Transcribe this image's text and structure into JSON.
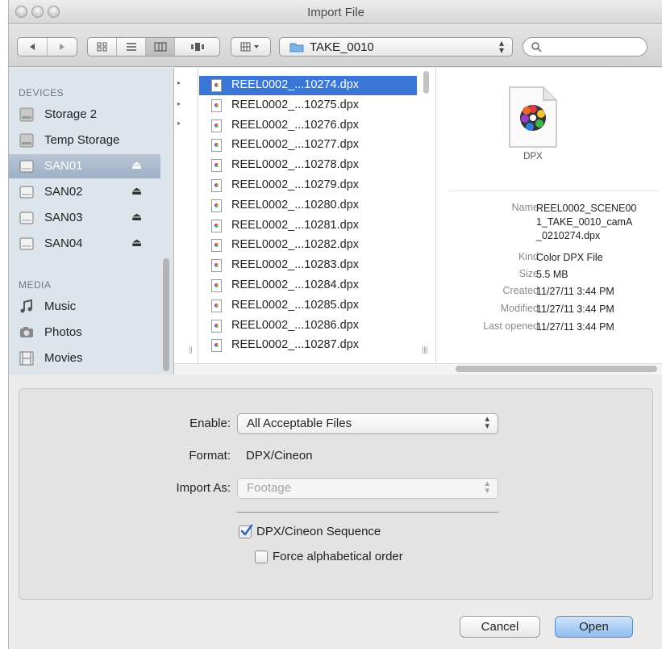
{
  "window": {
    "title": "Import File"
  },
  "toolbar": {
    "nav_back_icon": "back-arrow-icon",
    "nav_forward_icon": "forward-arrow-icon",
    "view_modes": [
      "icon-view",
      "list-view",
      "column-view",
      "coverflow-view"
    ],
    "active_view": "column-view",
    "arrange_icon": "arrange-grid-icon",
    "path": "TAKE_0010",
    "search_placeholder": ""
  },
  "sidebar": {
    "devices_header": "DEVICES",
    "devices": [
      {
        "label": "Storage 2",
        "icon": "internal-disk-icon",
        "eject": false,
        "selected": false
      },
      {
        "label": "Temp Storage",
        "icon": "internal-disk-icon",
        "eject": false,
        "selected": false
      },
      {
        "label": "SAN01",
        "icon": "external-disk-icon",
        "eject": true,
        "selected": true
      },
      {
        "label": "SAN02",
        "icon": "external-disk-icon",
        "eject": true,
        "selected": false
      },
      {
        "label": "SAN03",
        "icon": "external-disk-icon",
        "eject": true,
        "selected": false
      },
      {
        "label": "SAN04",
        "icon": "external-disk-icon",
        "eject": true,
        "selected": false
      }
    ],
    "media_header": "MEDIA",
    "media": [
      {
        "label": "Music",
        "icon": "music-note-icon"
      },
      {
        "label": "Photos",
        "icon": "camera-icon"
      },
      {
        "label": "Movies",
        "icon": "film-icon"
      }
    ],
    "eject_symbol": "⏏"
  },
  "files": [
    "REEL0002_...10274.dpx",
    "REEL0002_...10275.dpx",
    "REEL0002_...10276.dpx",
    "REEL0002_...10277.dpx",
    "REEL0002_...10278.dpx",
    "REEL0002_...10279.dpx",
    "REEL0002_...10280.dpx",
    "REEL0002_...10281.dpx",
    "REEL0002_...10282.dpx",
    "REEL0002_...10283.dpx",
    "REEL0002_...10284.dpx",
    "REEL0002_...10285.dpx",
    "REEL0002_...10286.dpx",
    "REEL0002_...10287.dpx"
  ],
  "selected_file_index": 0,
  "preview": {
    "icon_label": "DPX",
    "name_key": "Name",
    "name_value_lines": [
      "REEL0002_SCENE00",
      "1_TAKE_0010_camA",
      "_0210274.dpx"
    ],
    "kind_key": "Kind",
    "kind_value": "Color DPX File",
    "size_key": "Size",
    "size_value": "5.5 MB",
    "created_key": "Created",
    "created_value": "11/27/11 3:44 PM",
    "modified_key": "Modified",
    "modified_value": "11/27/11 3:44 PM",
    "last_opened_key": "Last opened",
    "last_opened_value": "11/27/11 3:44 PM"
  },
  "options": {
    "enable_label": "Enable:",
    "enable_value": "All Acceptable Files",
    "format_label": "Format:",
    "format_value": "DPX/Cineon",
    "import_as_label": "Import As:",
    "import_as_value": "Footage",
    "sequence_label": "DPX/Cineon Sequence",
    "sequence_checked": true,
    "alpha_label": "Force alphabetical order",
    "alpha_checked": false
  },
  "buttons": {
    "cancel": "Cancel",
    "open": "Open"
  }
}
